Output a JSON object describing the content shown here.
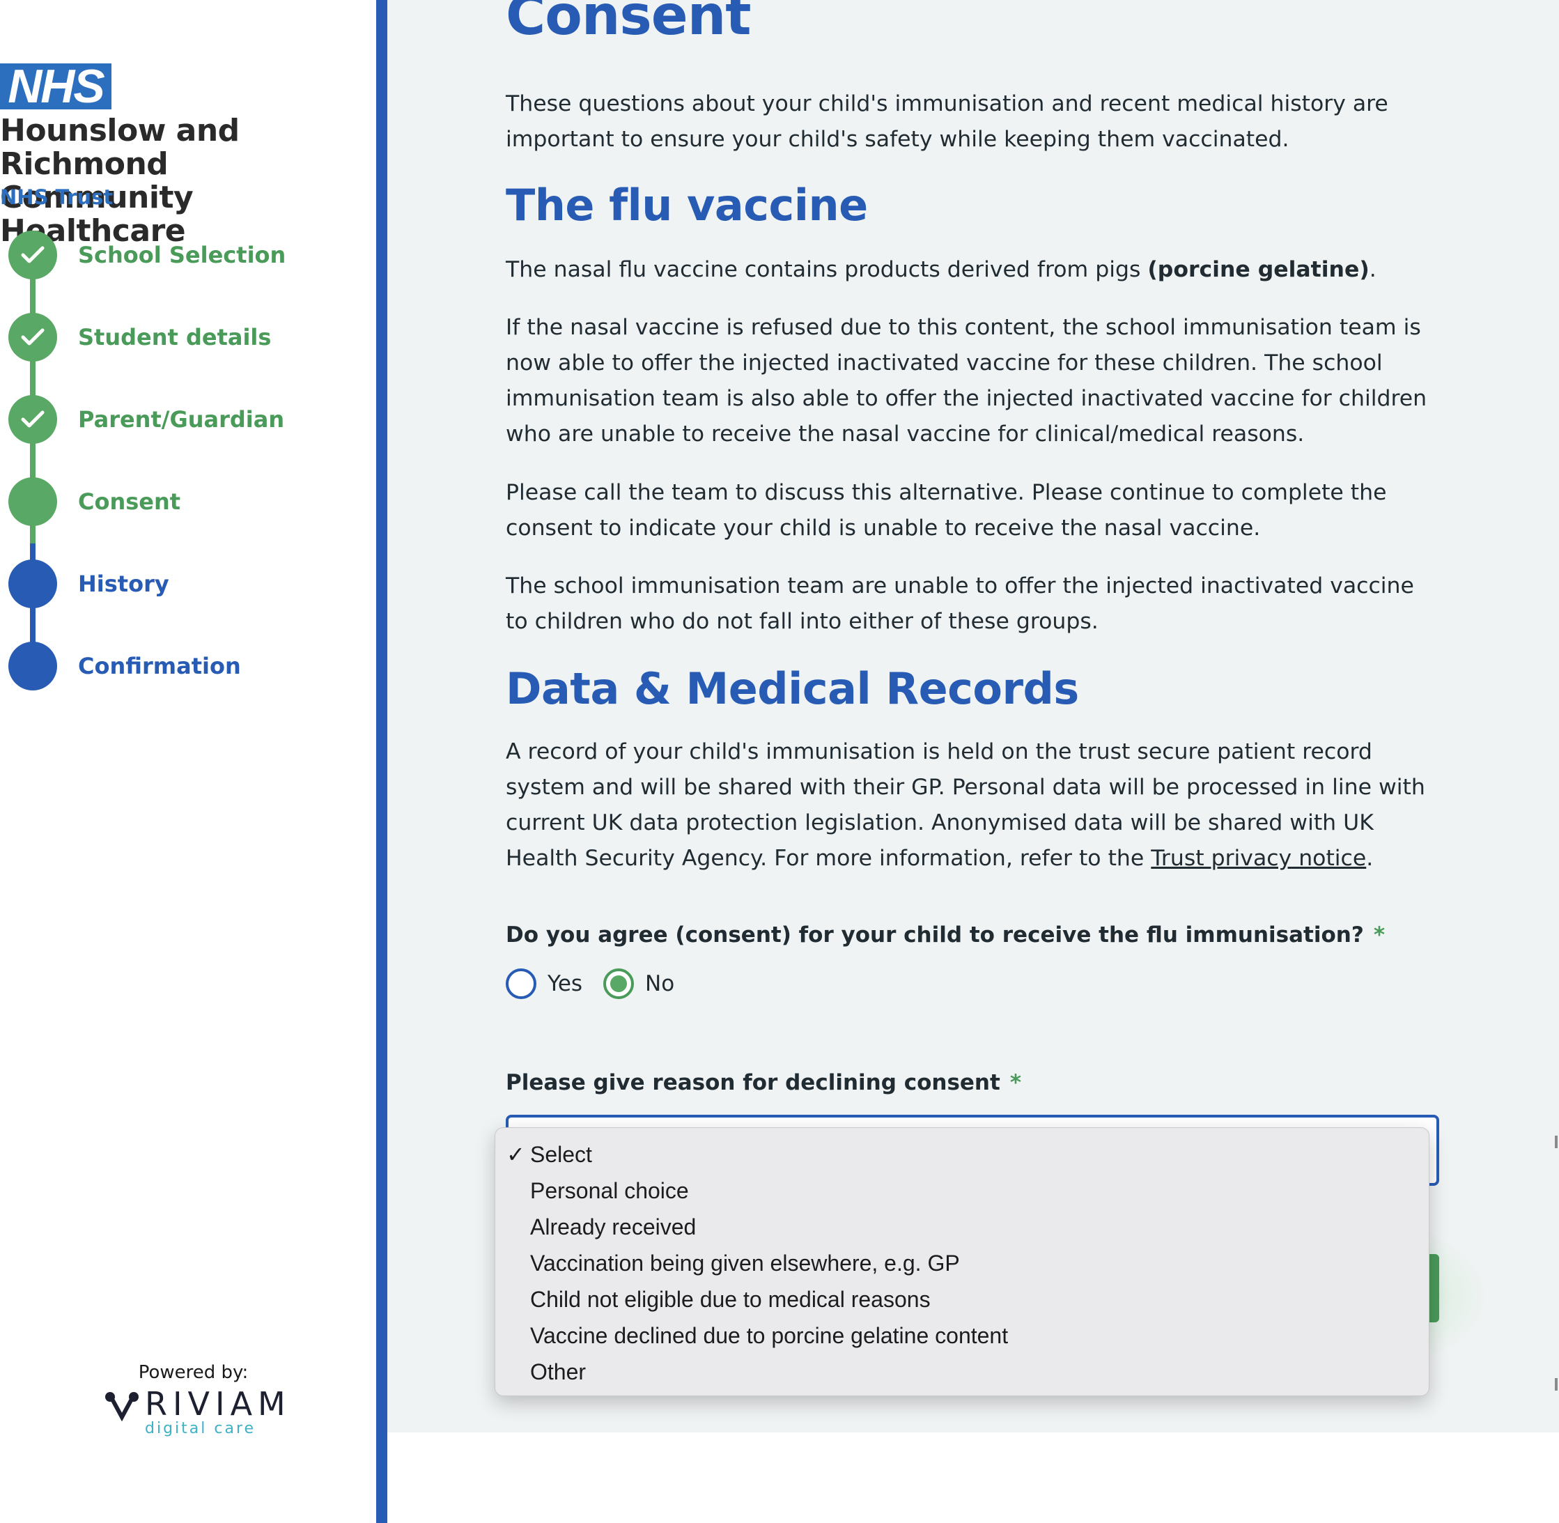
{
  "sidebar": {
    "logo_text": "NHS",
    "org_name_line1": "Hounslow and Richmond",
    "org_name_line2": "Community Healthcare",
    "org_trust": "NHS Trust",
    "steps": [
      {
        "label": "School Selection",
        "state": "complete"
      },
      {
        "label": "Student details",
        "state": "complete"
      },
      {
        "label": "Parent/Guardian",
        "state": "complete"
      },
      {
        "label": "Consent",
        "state": "current"
      },
      {
        "label": "History",
        "state": "upcoming"
      },
      {
        "label": "Confirmation",
        "state": "upcoming"
      }
    ],
    "powered_by": "Powered by:",
    "vendor_name": "RIVIAM",
    "vendor_tagline": "digital care"
  },
  "colors": {
    "primary_blue": "#285cb4",
    "complete_green": "#5aa865",
    "step_green_text": "#4a9b5a",
    "main_background": "#f0f3f4"
  },
  "main": {
    "title": "Consent",
    "intro": "These questions about your child's immunisation and recent medical history are important to ensure your child's safety while keeping them vaccinated.",
    "flu_heading": "The flu vaccine",
    "flu_p1_text": "The nasal flu vaccine contains products derived from pigs ",
    "flu_p1_bold": "(porcine gelatine)",
    "flu_p1_end": ".",
    "flu_p2": "If the nasal vaccine is refused due to this content, the school immunisation team is now able to offer the injected inactivated vaccine for these children. The school immunisation team is also able to offer the injected inactivated vaccine for children who are unable to receive the nasal vaccine for clinical/medical reasons.",
    "flu_p3": "Please call the team to discuss this alternative. Please continue to complete the consent to indicate your child is unable to receive the nasal vaccine.",
    "flu_p4": "The school immunisation team are unable to offer the injected inactivated vaccine to children who do not fall into either of these groups.",
    "data_heading": "Data & Medical Records",
    "data_p_text": "A record of your child's immunisation is held on the trust secure patient record system and will be shared with their GP. Personal data will be processed in line with current UK data protection legislation. Anonymised data will be shared with UK Health Security Agency. For more information, refer to the ",
    "data_p_link": "Trust privacy notice",
    "data_p_end": ".",
    "consent_question": "Do you agree (consent) for your child to receive the flu immunisation?",
    "required_mark": "*",
    "consent_options": [
      {
        "label": "Yes",
        "selected": false
      },
      {
        "label": "No",
        "selected": true
      }
    ],
    "decline_label": "Please give reason for declining consent",
    "decline_select": {
      "selected": "Select",
      "checkmark": "✓",
      "options": [
        "Select",
        "Personal choice",
        "Already received",
        "Vaccination being given elsewhere, e.g. GP",
        "Child not eligible due to medical reasons",
        "Vaccine declined due to porcine gelatine content",
        "Other"
      ]
    }
  }
}
